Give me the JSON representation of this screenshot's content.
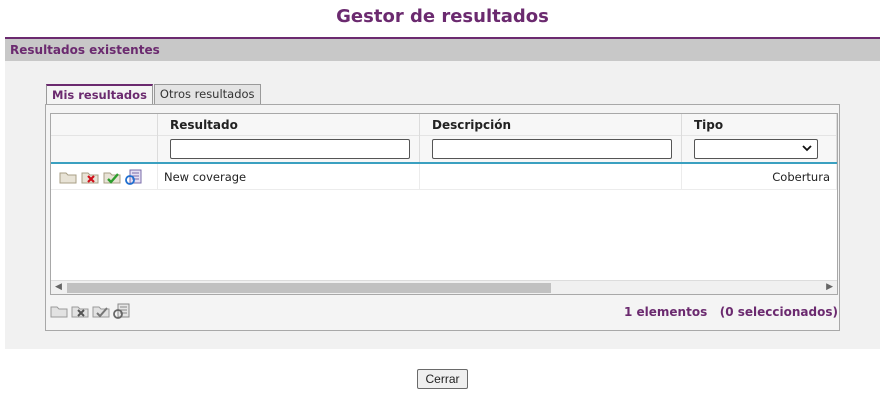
{
  "page": {
    "title": "Gestor de resultados"
  },
  "section": {
    "header": "Resultados existentes"
  },
  "tabs": [
    {
      "label": "Mis resultados",
      "active": true
    },
    {
      "label": "Otros resultados",
      "active": false
    }
  ],
  "grid": {
    "columns": [
      "",
      "Resultado",
      "Descripción",
      "Tipo"
    ],
    "type_filter_value": "",
    "rows": [
      {
        "resultado": "New coverage",
        "descripcion": "",
        "tipo": "Cobertura"
      }
    ]
  },
  "footer": {
    "count_text": "1 elementos   (0 seleccionados)"
  },
  "buttons": {
    "close": "Cerrar"
  },
  "colors": {
    "accent": "#6b2a6f",
    "header_bg": "#c8c8c8",
    "panel_bg": "#f1f1f1",
    "divider": "#3aa0c0"
  }
}
